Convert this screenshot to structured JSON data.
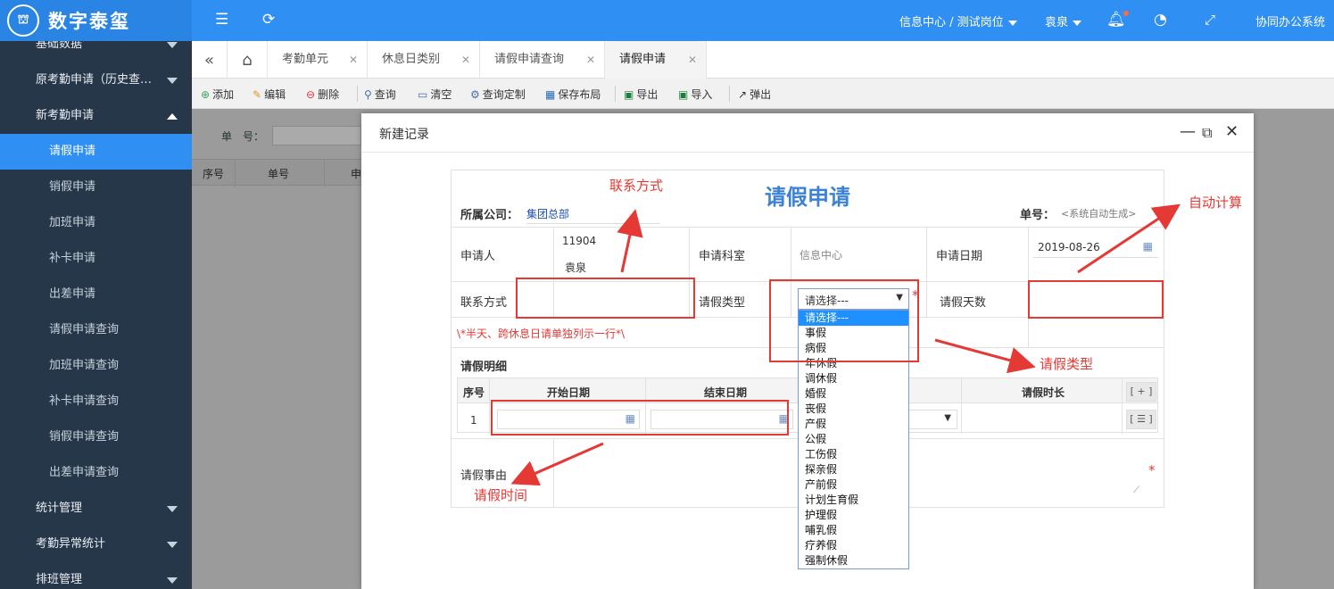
{
  "app": {
    "logo_mark": "⛫",
    "logo_text": "数字泰玺"
  },
  "topbar": {
    "org": "信息中心 / 测试岗位",
    "user": "袁泉",
    "right_label": "协同办公系统"
  },
  "sidebar": {
    "items": [
      {
        "type": "group",
        "label": "基础数据",
        "arrow": "down"
      },
      {
        "type": "group",
        "label": "原考勤申请（历史查…",
        "arrow": "down"
      },
      {
        "type": "group",
        "label": "新考勤申请",
        "arrow": "up"
      },
      {
        "type": "item",
        "label": "请假申请",
        "active": true
      },
      {
        "type": "item",
        "label": "销假申请"
      },
      {
        "type": "item",
        "label": "加班申请"
      },
      {
        "type": "item",
        "label": "补卡申请"
      },
      {
        "type": "item",
        "label": "出差申请"
      },
      {
        "type": "item",
        "label": "请假申请查询"
      },
      {
        "type": "item",
        "label": "加班申请查询"
      },
      {
        "type": "item",
        "label": "补卡申请查询"
      },
      {
        "type": "item",
        "label": "销假申请查询"
      },
      {
        "type": "item",
        "label": "出差申请查询"
      },
      {
        "type": "group",
        "label": "统计管理",
        "arrow": "down"
      },
      {
        "type": "group",
        "label": "考勤异常统计",
        "arrow": "down"
      },
      {
        "type": "group",
        "label": "排班管理",
        "arrow": "down"
      }
    ]
  },
  "tabs": [
    {
      "label": "考勤单元"
    },
    {
      "label": "休息日类别"
    },
    {
      "label": "请假申请查询"
    },
    {
      "label": "请假申请",
      "active": true
    }
  ],
  "toolbar": {
    "add": "添加",
    "edit": "编辑",
    "delete": "删除",
    "query": "查询",
    "clear": "清空",
    "custom": "查询定制",
    "save_layout": "保存布局",
    "export": "导出",
    "import": "导入",
    "popup": "弹出"
  },
  "search": {
    "label": "单　号："
  },
  "grid": {
    "col_seq": "序号",
    "col_no": "单号",
    "col_more": "申"
  },
  "dialog": {
    "title": "新建记录"
  },
  "form": {
    "title": "请假申请",
    "company_label": "所属公司：",
    "company_value": "集团总部",
    "docno_label": "单号：",
    "docno_value": "<系统自动生成>",
    "applicant_label": "申请人",
    "applicant_id": "11904",
    "applicant_name": "袁泉",
    "dept_label": "申请科室",
    "dept_value": "信息中心",
    "date_label": "申请日期",
    "date_value": "2019-08-26",
    "contact_label": "联系方式",
    "leave_type_label": "请假类型",
    "leave_type_value": "请选择---",
    "days_label": "请假天数",
    "note": "\\*半天、跨休息日请单独列示一行*\\",
    "detail_title": "请假明细",
    "col_seq": "序号",
    "col_start": "开始日期",
    "col_end": "结束日期",
    "col_duration": "请假时长",
    "add_row": "[ + ]",
    "row_seq": "1",
    "row_menu": "[ ☰ ]",
    "reason_label": "请假事由",
    "required_mark": "*"
  },
  "dropdown": {
    "options": [
      "请选择---",
      "事假",
      "病假",
      "年休假",
      "调休假",
      "婚假",
      "丧假",
      "产假",
      "公假",
      "工伤假",
      "探亲假",
      "产前假",
      "计划生育假",
      "护理假",
      "哺乳假",
      "疗养假",
      "强制休假"
    ],
    "selected_index": 0
  },
  "annotations": {
    "contact": "联系方式",
    "auto_calc": "自动计算",
    "leave_type": "请假类型",
    "leave_time": "请假时间"
  },
  "colors": {
    "primary": "#2f8ff2",
    "sidebar": "#253749",
    "annotation_red": "#e53935"
  }
}
